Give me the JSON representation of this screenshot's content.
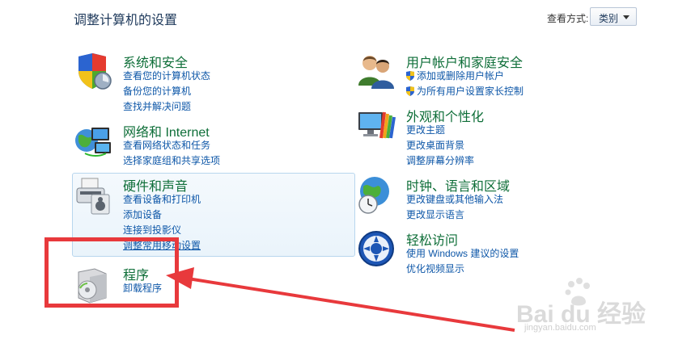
{
  "header": {
    "title": "调整计算机的设置",
    "view_by_label": "查看方式:",
    "view_by_value": "类别"
  },
  "categories": {
    "system": {
      "title": "系统和安全",
      "links": [
        "查看您的计算机状态",
        "备份您的计算机",
        "查找并解决问题"
      ],
      "icon": "system-security-icon"
    },
    "network": {
      "title": "网络和 Internet",
      "links": [
        "查看网络状态和任务",
        "选择家庭组和共享选项"
      ],
      "icon": "network-icon"
    },
    "hardware": {
      "title": "硬件和声音",
      "links": [
        "查看设备和打印机",
        "添加设备",
        "连接到投影仪",
        "调整常用移动设置"
      ],
      "icon": "printer-icon"
    },
    "programs": {
      "title": "程序",
      "links": [
        "卸载程序"
      ],
      "icon": "programs-icon"
    },
    "users": {
      "title": "用户帐户和家庭安全",
      "links": [
        "添加或删除用户帐户",
        "为所有用户设置家长控制"
      ],
      "icon": "users-icon"
    },
    "appearance": {
      "title": "外观和个性化",
      "links": [
        "更改主题",
        "更改桌面背景",
        "调整屏幕分辨率"
      ],
      "icon": "monitor-palette-icon"
    },
    "clock": {
      "title": "时钟、语言和区域",
      "links": [
        "更改键盘或其他输入法",
        "更改显示语言"
      ],
      "icon": "globe-clock-icon"
    },
    "ease": {
      "title": "轻松访问",
      "links": [
        "使用 Windows 建议的设置",
        "优化视频显示"
      ],
      "icon": "ease-of-access-icon"
    }
  },
  "watermark": {
    "brand": "Bai du 经验",
    "url": "jingyan.baidu.com"
  },
  "colors": {
    "title_green": "#0e6e38",
    "link_blue": "#0e57a8",
    "annotation_red": "#e8393c"
  }
}
